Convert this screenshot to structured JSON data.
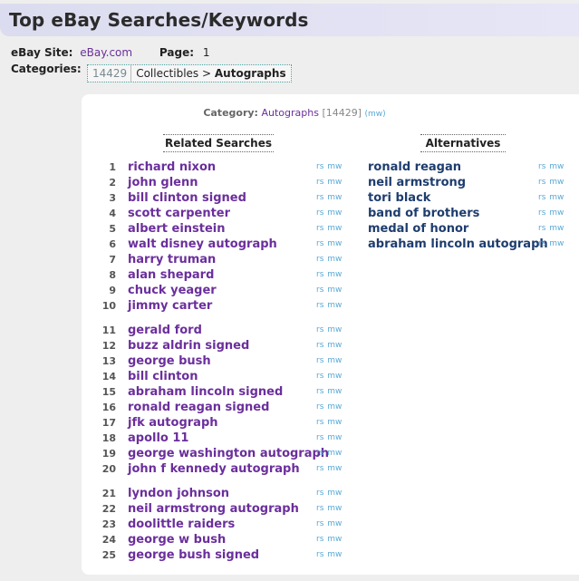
{
  "header": {
    "title": "Top eBay Searches/Keywords"
  },
  "meta": {
    "site_label": "eBay Site:",
    "site_value": "eBay.com",
    "page_label": "Page:",
    "page_value": "1",
    "categories_label": "Categories:",
    "category_id": "14429",
    "category_path": "Collectibles >",
    "category_leaf": "Autographs"
  },
  "panel": {
    "category_label": "Category:",
    "category_name": "Autographs",
    "category_id": "[14429]",
    "mw_link": "(mw)",
    "related_heading": "Related Searches",
    "alternatives_heading": "Alternatives",
    "tool_rs": "rs",
    "tool_mw": "mw"
  },
  "related_searches": [
    {
      "rank": "1",
      "keyword": "richard nixon"
    },
    {
      "rank": "2",
      "keyword": "john glenn"
    },
    {
      "rank": "3",
      "keyword": "bill clinton signed"
    },
    {
      "rank": "4",
      "keyword": "scott carpenter"
    },
    {
      "rank": "5",
      "keyword": "albert einstein"
    },
    {
      "rank": "6",
      "keyword": "walt disney autograph"
    },
    {
      "rank": "7",
      "keyword": "harry truman"
    },
    {
      "rank": "8",
      "keyword": "alan shepard"
    },
    {
      "rank": "9",
      "keyword": "chuck yeager"
    },
    {
      "rank": "10",
      "keyword": "jimmy carter"
    },
    {
      "rank": "11",
      "keyword": "gerald ford"
    },
    {
      "rank": "12",
      "keyword": "buzz aldrin signed"
    },
    {
      "rank": "13",
      "keyword": "george bush"
    },
    {
      "rank": "14",
      "keyword": "bill clinton"
    },
    {
      "rank": "15",
      "keyword": "abraham lincoln signed"
    },
    {
      "rank": "16",
      "keyword": "ronald reagan signed"
    },
    {
      "rank": "17",
      "keyword": "jfk autograph"
    },
    {
      "rank": "18",
      "keyword": "apollo 11"
    },
    {
      "rank": "19",
      "keyword": "george washington autograph"
    },
    {
      "rank": "20",
      "keyword": "john f kennedy autograph"
    },
    {
      "rank": "21",
      "keyword": "lyndon johnson"
    },
    {
      "rank": "22",
      "keyword": "neil armstrong autograph"
    },
    {
      "rank": "23",
      "keyword": "doolittle raiders"
    },
    {
      "rank": "24",
      "keyword": "george w bush"
    },
    {
      "rank": "25",
      "keyword": "george bush signed"
    }
  ],
  "alternatives": [
    {
      "keyword": "ronald reagan"
    },
    {
      "keyword": "neil armstrong"
    },
    {
      "keyword": "tori black"
    },
    {
      "keyword": "band of brothers"
    },
    {
      "keyword": "medal of honor"
    },
    {
      "keyword": "abraham lincoln autograph"
    }
  ]
}
